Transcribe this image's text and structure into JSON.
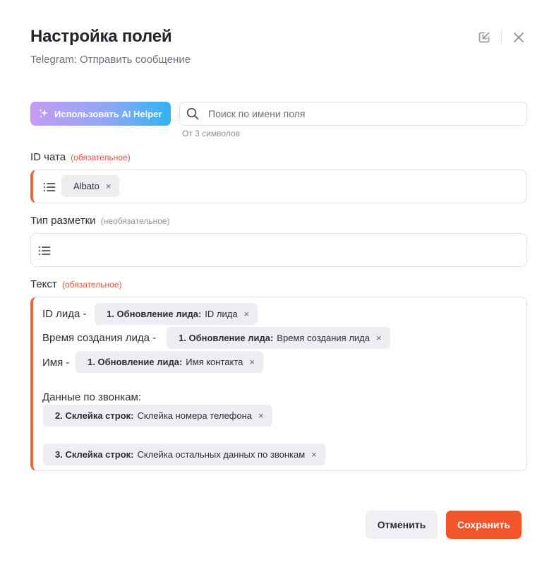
{
  "header": {
    "title": "Настройка полей",
    "subtitle": "Telegram: Отправить сообщение"
  },
  "toolbar": {
    "ai_button_label": "Использовать AI Helper",
    "search_placeholder": "Поиск по имени поля",
    "search_value": "",
    "search_hint": "От 3 символов"
  },
  "fields": {
    "chat_id": {
      "label": "ID чата",
      "status": "(обязательное)",
      "tags": [
        {
          "source": "",
          "value": "Albato"
        }
      ]
    },
    "markup": {
      "label": "Тип разметки",
      "status": "(необязательное)"
    },
    "text": {
      "label": "Текст",
      "status": "(обязательное)",
      "lines": [
        {
          "prefix": "ID лида -",
          "tag_source": "1. Обновление лида:",
          "tag_value": "ID лида"
        },
        {
          "prefix": "Время создания лида -",
          "tag_source": "1. Обновление лида:",
          "tag_value": "Время создания лида"
        },
        {
          "prefix": "Имя -",
          "tag_source": "1. Обновление лида:",
          "tag_value": "Имя контакта"
        }
      ],
      "calls_heading": "Данные по звонкам:",
      "calls_tags": [
        {
          "tag_source": "2. Склейка строк:",
          "tag_value": "Склейка номера телефона"
        },
        {
          "tag_source": "3. Склейка строк:",
          "tag_value": "Склейка остальных данных по звонкам"
        }
      ]
    }
  },
  "footer": {
    "cancel_label": "Отменить",
    "save_label": "Сохранить"
  },
  "icons": {
    "remove": "×",
    "sparkle": "sparkle-icon",
    "search": "search-icon",
    "list": "list-icon",
    "collapse": "collapse-icon",
    "close": "close-icon"
  },
  "colors": {
    "accent": "#f4562b",
    "required_bar": "#f0673e",
    "required_text": "#e5533a",
    "ai_gradient_start": "#c59bf5",
    "ai_gradient_end": "#2fb3f3",
    "tag_bg": "#eceef1"
  }
}
